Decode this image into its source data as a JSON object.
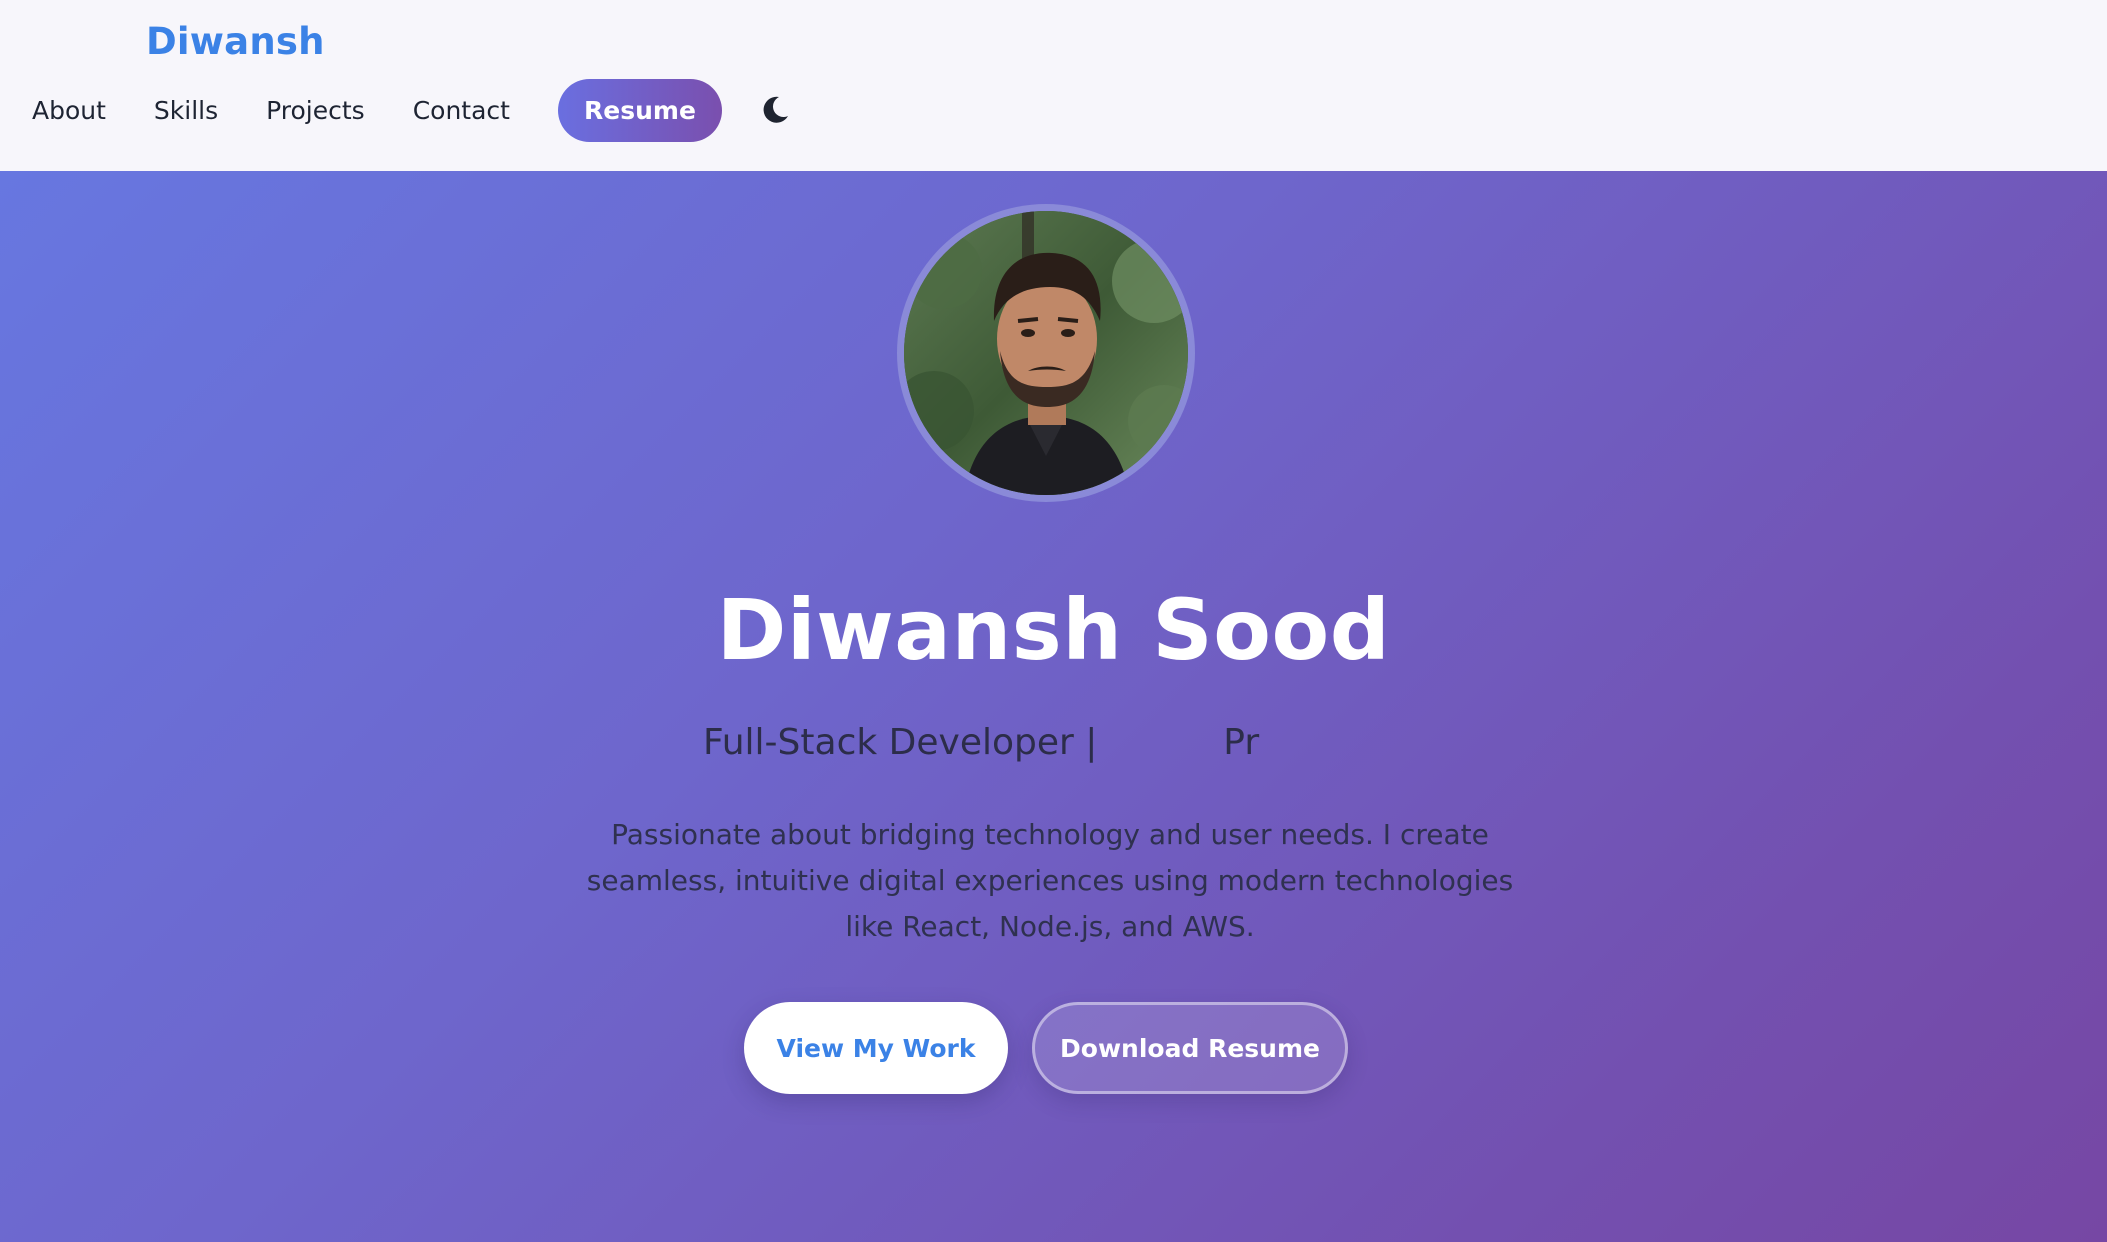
{
  "header": {
    "brand": "Diwansh",
    "nav": [
      "About",
      "Skills",
      "Projects",
      "Contact"
    ],
    "resume_label": "Resume",
    "theme_icon": "moon-icon"
  },
  "hero": {
    "avatar_icon": "profile-photo",
    "name": "Diwansh Sood",
    "role_typed": "Full-Stack Developer |           Pr",
    "description": "Passionate about bridging technology and user needs. I create seamless, intuitive digital experiences using modern technologies like React, Node.js, and AWS.",
    "primary_cta": "View My Work",
    "secondary_cta": "Download Resume"
  },
  "colors": {
    "brand": "#3b82e6",
    "nav_text": "#1e2433",
    "hero_gradient_start": "#6777e0",
    "hero_gradient_end": "#7647a4"
  }
}
